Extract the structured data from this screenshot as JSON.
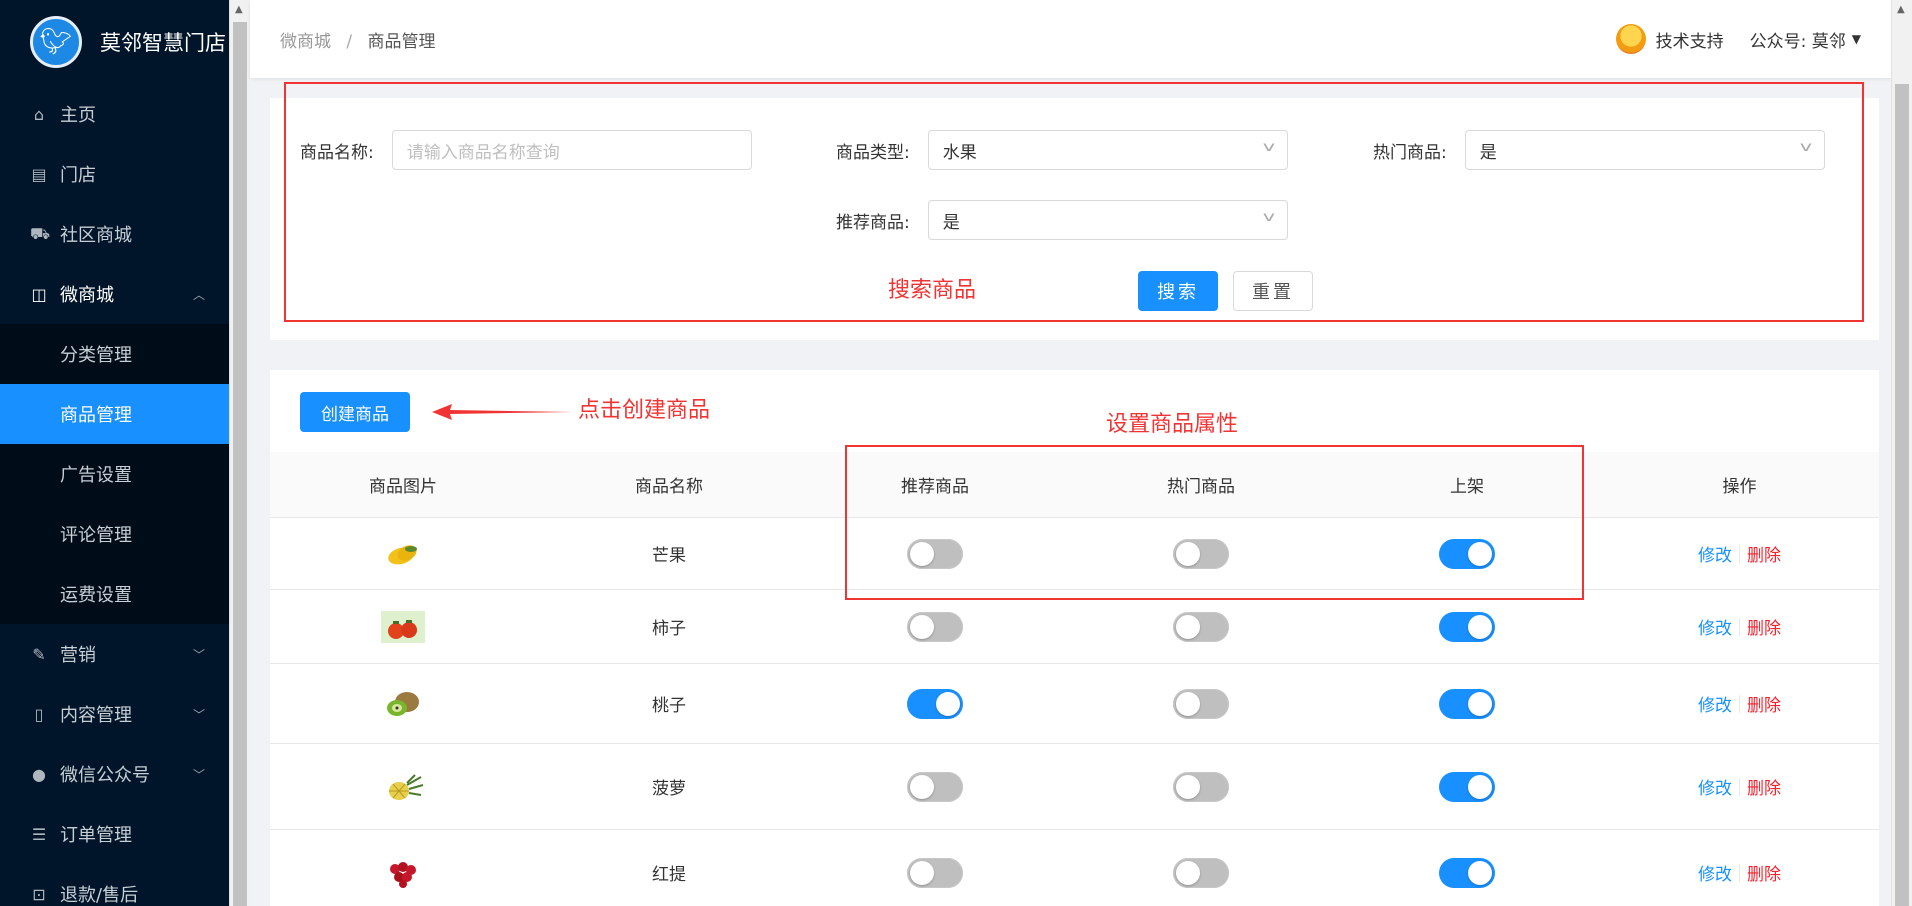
{
  "sidebar": {
    "app_name": "莫邻智慧门店",
    "items": [
      {
        "label": "主页",
        "icon": "home-icon"
      },
      {
        "label": "门店",
        "icon": "store-icon"
      },
      {
        "label": "社区商城",
        "icon": "cart-icon"
      },
      {
        "label": "微商城",
        "icon": "bag-icon",
        "expanded": true
      },
      {
        "label": "营销",
        "icon": "wrench-icon"
      },
      {
        "label": "内容管理",
        "icon": "document-icon"
      },
      {
        "label": "微信公众号",
        "icon": "wechat-icon"
      },
      {
        "label": "订单管理",
        "icon": "list-icon"
      },
      {
        "label": "退款/售后",
        "icon": "refund-icon"
      }
    ],
    "submenu": [
      "分类管理",
      "商品管理",
      "广告设置",
      "评论管理",
      "运费设置"
    ],
    "active_submenu": "商品管理"
  },
  "header": {
    "breadcrumb": [
      "微商城",
      "商品管理"
    ],
    "breadcrumb_sep": "/",
    "support_label": "技术支持",
    "account_label": "公众号: 莫邻"
  },
  "search": {
    "name_label": "商品名称:",
    "name_placeholder": "请输入商品名称查询",
    "type_label": "商品类型:",
    "type_value": "水果",
    "hot_label": "热门商品:",
    "hot_value": "是",
    "recommend_label": "推荐商品:",
    "recommend_value": "是",
    "search_button": "搜索",
    "reset_button": "重置"
  },
  "table": {
    "create_button": "创建商品",
    "columns": [
      "商品图片",
      "商品名称",
      "推荐商品",
      "热门商品",
      "上架",
      "操作"
    ],
    "edit_label": "修改",
    "delete_label": "删除",
    "rows": [
      {
        "name": "芒果",
        "image": "mango",
        "recommend": false,
        "hot": false,
        "on_shelf": true
      },
      {
        "name": "柿子",
        "image": "persimmon",
        "recommend": false,
        "hot": false,
        "on_shelf": true
      },
      {
        "name": "桃子",
        "image": "peach",
        "recommend": true,
        "hot": false,
        "on_shelf": true
      },
      {
        "name": "菠萝",
        "image": "pineapple",
        "recommend": false,
        "hot": false,
        "on_shelf": true
      },
      {
        "name": "红提",
        "image": "red-grape",
        "recommend": false,
        "hot": false,
        "on_shelf": true
      }
    ]
  },
  "annotations": {
    "search_note": "搜索商品",
    "create_note": "点击创建商品",
    "attr_note": "设置商品属性"
  },
  "colors": {
    "sidebar_bg": "#001529",
    "primary": "#1890ff",
    "danger": "#f5222d",
    "annotation": "#f03434"
  }
}
